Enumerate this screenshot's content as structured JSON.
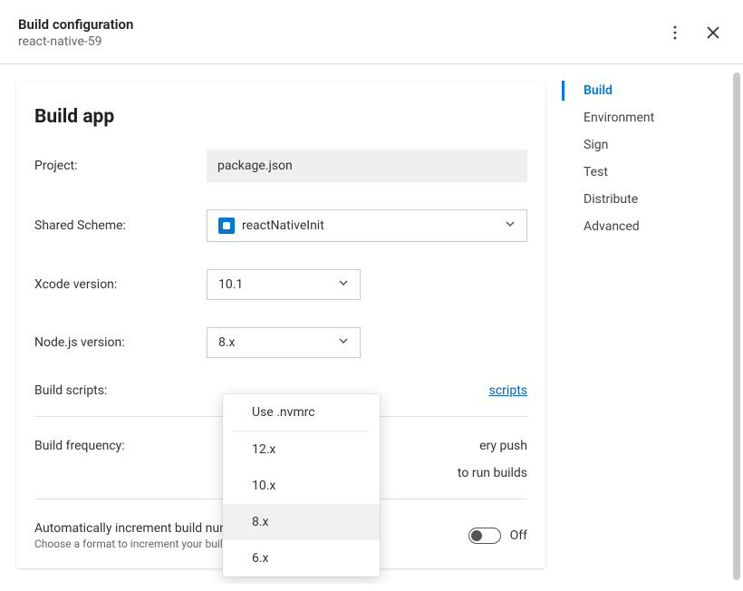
{
  "header": {
    "title": "Build configuration",
    "subtitle": "react-native-59"
  },
  "sidebar": {
    "items": [
      {
        "label": "Build",
        "active": true
      },
      {
        "label": "Environment"
      },
      {
        "label": "Sign"
      },
      {
        "label": "Test"
      },
      {
        "label": "Distribute"
      },
      {
        "label": "Advanced"
      }
    ]
  },
  "main": {
    "title": "Build app",
    "project": {
      "label": "Project:",
      "value": "package.json"
    },
    "scheme": {
      "label": "Shared Scheme:",
      "value": "reactNativeInit"
    },
    "xcode": {
      "label": "Xcode version:",
      "value": "10.1"
    },
    "node": {
      "label": "Node.js version:",
      "value": "8.x"
    },
    "build_scripts": {
      "label": "Build scripts:",
      "link_suffix": "scripts"
    },
    "frequency": {
      "label": "Build frequency:",
      "opt1_suffix": "ery push",
      "opt2_suffix": "to run builds"
    },
    "auto_increment": {
      "title": "Automatically increment build number",
      "subtitle": "Choose a format to increment your builds.",
      "state_label": "Off"
    }
  },
  "node_dropdown": {
    "top_option": "Use .nvmrc",
    "options": [
      "12.x",
      "10.x",
      "8.x",
      "6.x"
    ],
    "selected": "8.x"
  }
}
